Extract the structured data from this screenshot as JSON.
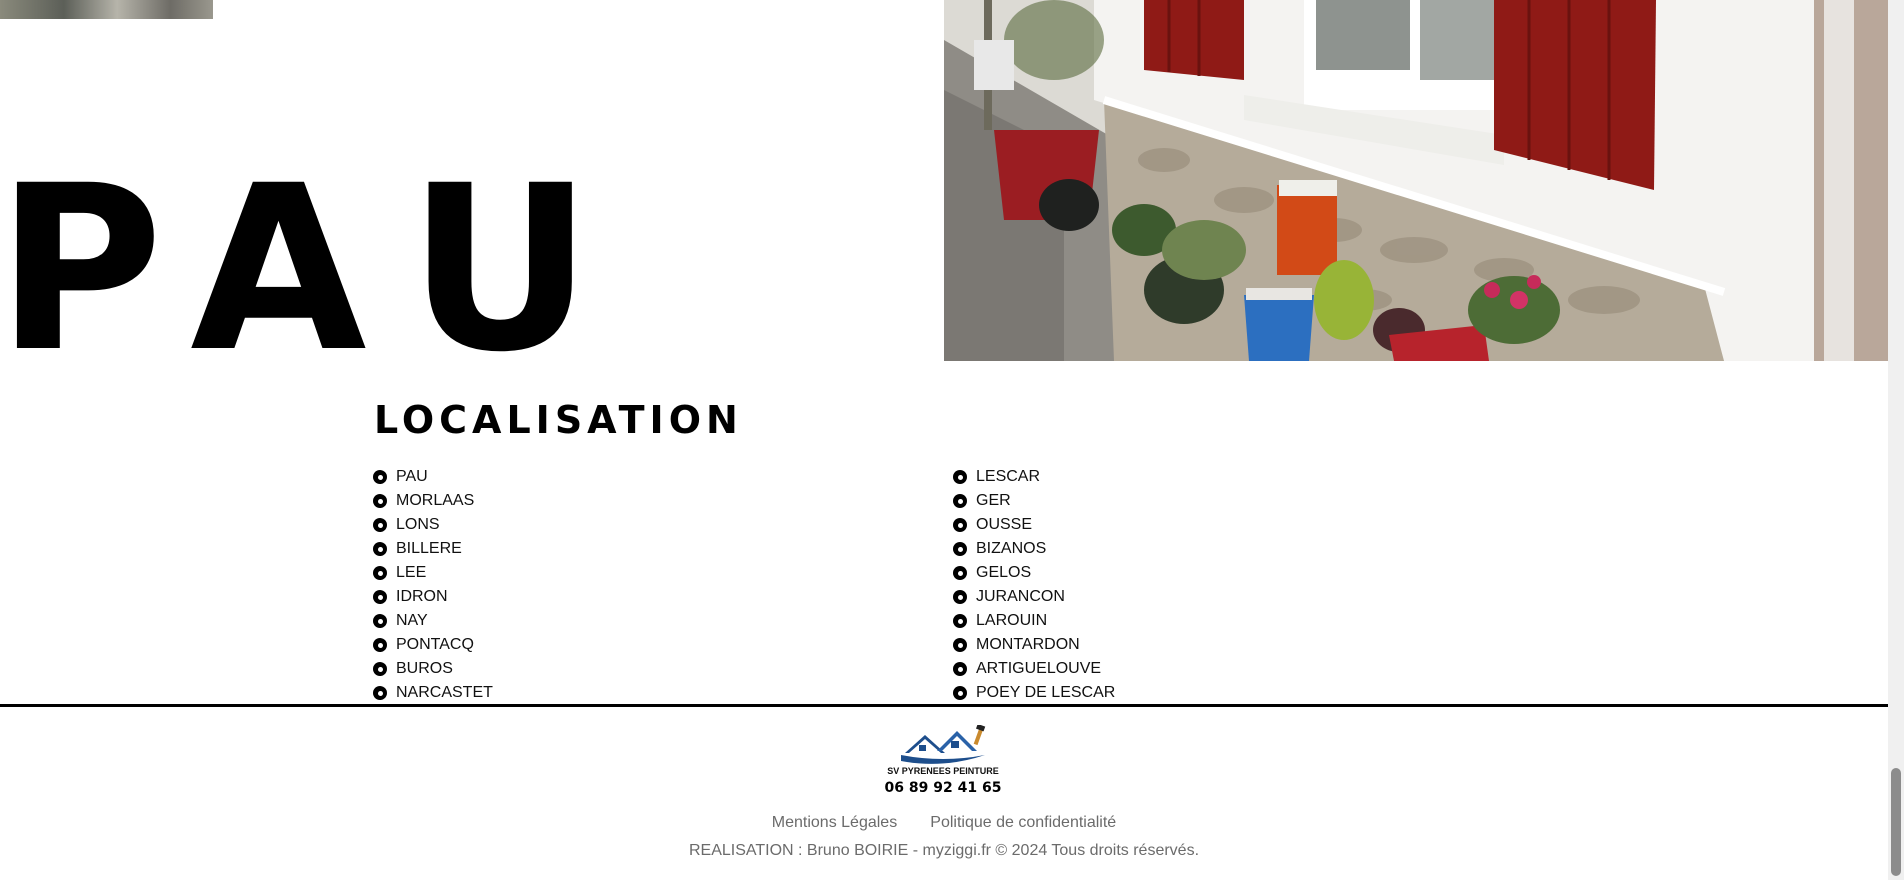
{
  "hero": {
    "title": "PAU"
  },
  "localisation": {
    "title": "LOCALISATION",
    "left_column": [
      "PAU",
      "MORLAAS",
      "LONS",
      "BILLERE",
      "LEE",
      "IDRON",
      "NAY",
      "PONTACQ",
      "BUROS",
      "NARCASTET"
    ],
    "right_column": [
      "LESCAR",
      "GER",
      "OUSSE",
      "BIZANOS",
      "GELOS",
      "JURANCON",
      "LAROUIN",
      "MONTARDON",
      "ARTIGUELOUVE",
      "POEY DE LESCAR"
    ]
  },
  "footer": {
    "logo_text": "SV PYRENEES PEINTURE",
    "phone": "06 89 92 41 65",
    "links": [
      "Mentions Légales",
      "Politique de confidentialité"
    ],
    "credits": "REALISATION : Bruno BOIRIE - myziggi.fr © 2024 Tous droits réservés."
  },
  "colors": {
    "shutter_red": "#8f1a16",
    "text_gray": "#6b6b6b",
    "logo_blue": "#1d4e8c"
  }
}
